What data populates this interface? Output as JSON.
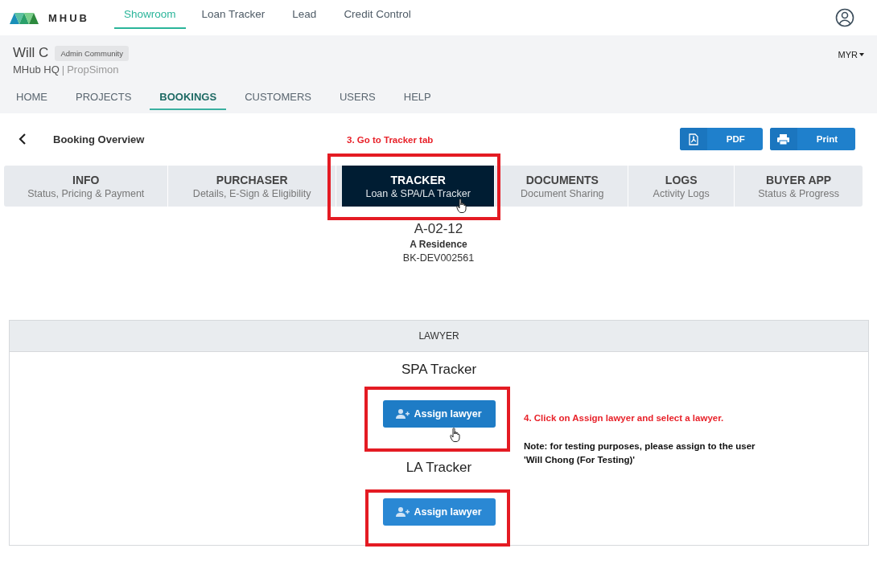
{
  "top_nav": {
    "logo_text": "MHUB",
    "items": [
      {
        "label": "Showroom",
        "selected": true
      },
      {
        "label": "Loan Tracker",
        "selected": false
      },
      {
        "label": "Lead",
        "selected": false
      },
      {
        "label": "Credit Control",
        "selected": false
      }
    ]
  },
  "header": {
    "user_name": "Will C",
    "role_badge": "Admin Community",
    "org": "MHub HQ",
    "separator": "|",
    "org_sub": "PropSimon",
    "currency": "MYR",
    "nav": [
      {
        "label": "HOME",
        "selected": false
      },
      {
        "label": "PROJECTS",
        "selected": false
      },
      {
        "label": "BOOKINGS",
        "selected": true
      },
      {
        "label": "CUSTOMERS",
        "selected": false
      },
      {
        "label": "USERS",
        "selected": false
      },
      {
        "label": "HELP",
        "selected": false
      }
    ]
  },
  "booking": {
    "title": "Booking Overview",
    "actions": [
      {
        "label": "PDF",
        "kind": "pdf"
      },
      {
        "label": "Print",
        "kind": "print"
      }
    ]
  },
  "tabs": [
    {
      "title": "INFO",
      "subtitle": "Status, Pricing & Payment",
      "selected": false
    },
    {
      "title": "PURCHASER",
      "subtitle": "Details, E-Sign & Eligibility",
      "selected": false
    },
    {
      "title": "TRACKER",
      "subtitle": "Loan & SPA/LA Tracker",
      "selected": true
    },
    {
      "title": "DOCUMENTS",
      "subtitle": "Document Sharing",
      "selected": false
    },
    {
      "title": "LOGS",
      "subtitle": "Activity Logs",
      "selected": false
    },
    {
      "title": "BUYER APP",
      "subtitle": "Status & Progress",
      "selected": false
    }
  ],
  "unit": {
    "code": "A-02-12",
    "project": "A Residence",
    "booking_no": "BK-DEV002561"
  },
  "lawyer": {
    "header": "LAWYER",
    "trackers": [
      {
        "title": "SPA Tracker",
        "button": "Assign lawyer"
      },
      {
        "title": "LA Tracker",
        "button": "Assign lawyer"
      }
    ]
  },
  "annotations": {
    "tab_step": "3. Go to Tracker tab",
    "lawyer_step": "4. Click on Assign lawyer and select a lawyer.",
    "lawyer_note": "Note: for testing purposes, please assign to the user 'Will Chong (For Testing)'"
  }
}
